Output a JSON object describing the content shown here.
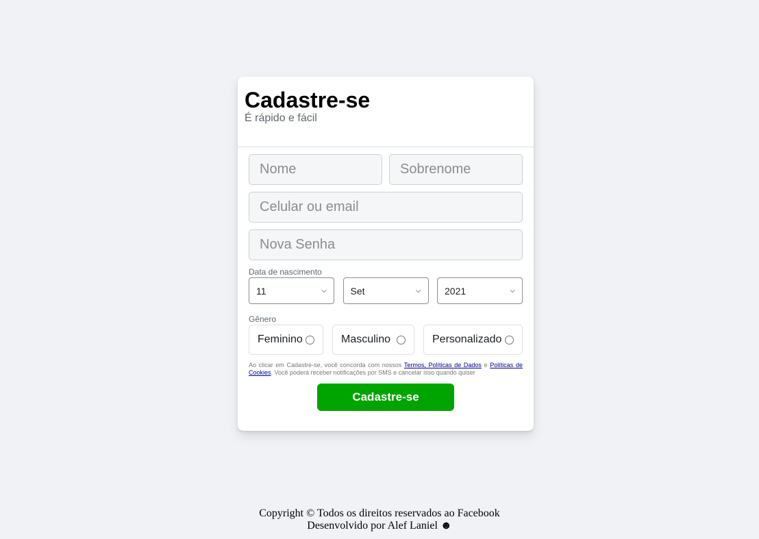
{
  "header": {
    "title": "Cadastre-se",
    "subtitle": "É rápido e fácil"
  },
  "form": {
    "first_name_placeholder": "Nome",
    "last_name_placeholder": "Sobrenome",
    "contact_placeholder": "Celular ou email",
    "password_placeholder": "Nova Senha",
    "birth_label": "Data de nascimento",
    "birth_day": "11",
    "birth_month": "Set",
    "birth_year": "2021",
    "gender_label": "Gênero",
    "genders": [
      "Feminino",
      "Masculino",
      "Personalizado"
    ],
    "terms_prefix": "Ao clicar em Cadastre-se, você concorda com nossos ",
    "terms_link": "Termos, Políticas de Dados",
    "terms_middle": " e ",
    "cookies_link": "Políticas de Cookies",
    "terms_suffix": ". Você poderá receber notificações por SMS e cancelar isso quando quiser",
    "submit_label": "Cadastre-se"
  },
  "footer": {
    "line1": "Copyright © Todos os direitos reservados ao Facebook",
    "line2": "Desenvolvido por Alef Laniel ☻"
  },
  "colors": {
    "accent": "#00a400",
    "background": "#f0f2f5",
    "link": "#00008b"
  }
}
